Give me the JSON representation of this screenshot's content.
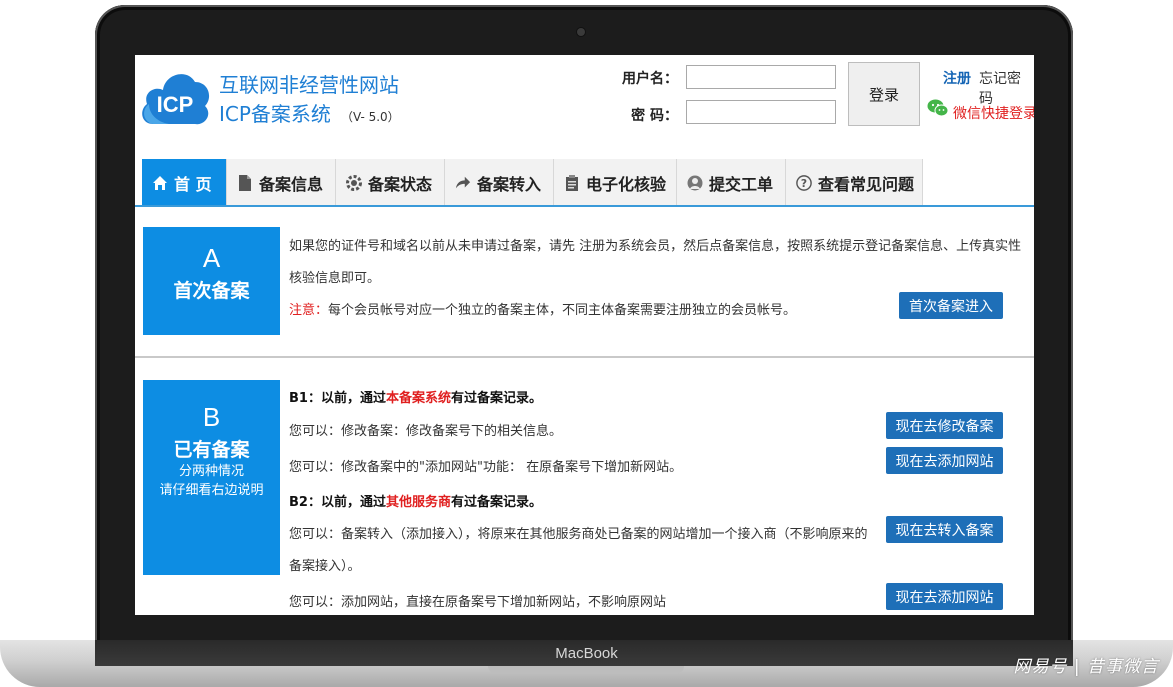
{
  "device": {
    "brand": "MacBook"
  },
  "watermark": "网易号 | 昔事微言",
  "header": {
    "logo_text": "ICP",
    "title_line1": "互联网非经营性网站",
    "title_line2": "ICP备案系统",
    "version": "（V- 5.0）",
    "brand_color": "#1f7fd4"
  },
  "login": {
    "username_label": "用户名：",
    "password_label": "密 码：",
    "username_value": "",
    "password_value": "",
    "login_button": "登录",
    "register_link": "注册",
    "forgot_link": "忘记密码",
    "wechat_link": "微信快捷登录"
  },
  "nav": {
    "tabs": [
      {
        "label": "首 页",
        "icon": "home-icon",
        "active": true
      },
      {
        "label": "备案信息",
        "icon": "document-icon"
      },
      {
        "label": "备案状态",
        "icon": "gear-icon"
      },
      {
        "label": "备案转入",
        "icon": "arrow-forward-icon"
      },
      {
        "label": "电子化核验",
        "icon": "clipboard-icon"
      },
      {
        "label": "提交工单",
        "icon": "user-icon"
      },
      {
        "label": "查看常见问题",
        "icon": "question-icon"
      }
    ],
    "active_color": "#0d8de3"
  },
  "section_a": {
    "letter": "A",
    "title": "首次备案",
    "desc_line1": "如果您的证件号和域名以前从未申请过备案，请先 注册为系统会员，然后点备案信息，按照系统提示登记备案信息、上传真实性",
    "desc_line2": "核验信息即可。",
    "note_label": "注意：",
    "note_text": "每个会员帐号对应一个独立的备案主体，不同主体备案需要注册独立的会员帐号。",
    "button": "首次备案进入"
  },
  "section_b": {
    "letter": "B",
    "title": "已有备案",
    "sub1": "分两种情况",
    "sub2": "请仔细看右边说明",
    "b1_prefix": "B1：以前，通过",
    "b1_highlight": "本备案系统",
    "b1_suffix": "有过备案记录。",
    "b1_item1": "您可以：修改备案：修改备案号下的相关信息。",
    "b1_item1_button": "现在去修改备案",
    "b1_item2": "您可以：修改备案中的\"添加网站\"功能： 在原备案号下增加新网站。",
    "b1_item2_button": "现在去添加网站",
    "b2_prefix": "B2：以前，通过",
    "b2_highlight": "其他服务商",
    "b2_suffix": "有过备案记录。",
    "b2_item1_line1": "您可以：备案转入（添加接入），将原来在其他服务商处已备案的网站增加一个接入商（不影响原来的",
    "b2_item1_line2": "备案接入）。",
    "b2_item1_button": "现在去转入备案",
    "b2_item2": "您可以：添加网站，直接在原备案号下增加新网站，不影响原网站",
    "b2_item2_button": "现在去添加网站"
  }
}
